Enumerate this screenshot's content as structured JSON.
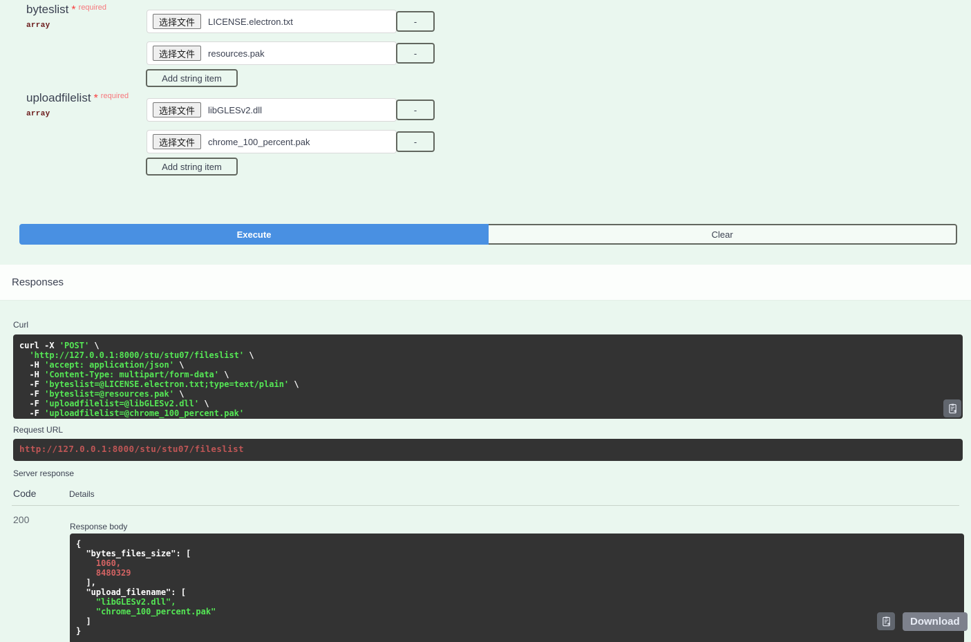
{
  "params": [
    {
      "name": "byteslist",
      "star": "*",
      "required": "required",
      "type": "array",
      "files": [
        {
          "button": "选择文件",
          "filename": "LICENSE.electron.txt",
          "remove": "-"
        },
        {
          "button": "选择文件",
          "filename": "resources.pak",
          "remove": "-"
        }
      ],
      "add_label": "Add string item"
    },
    {
      "name": "uploadfilelist",
      "star": "*",
      "required": "required",
      "type": "array",
      "files": [
        {
          "button": "选择文件",
          "filename": "libGLESv2.dll",
          "remove": "-"
        },
        {
          "button": "选择文件",
          "filename": "chrome_100_percent.pak",
          "remove": "-"
        }
      ],
      "add_label": "Add string item"
    }
  ],
  "actions": {
    "execute_label": "Execute",
    "clear_label": "Clear"
  },
  "responses": {
    "section_title": "Responses",
    "curl_label": "Curl",
    "request_url_label": "Request URL",
    "request_url": "http://127.0.0.1:8000/stu/stu07/fileslist",
    "server_response_label": "Server response",
    "col_code": "Code",
    "col_details": "Details",
    "status_code": "200",
    "response_body_label": "Response body",
    "download_label": "Download",
    "copy_icon_title": "copy-to-clipboard-icon",
    "curl": {
      "l1_cmd": "curl",
      "l1_flag": "-X",
      "l1_str": "'POST'",
      "l1_cont": "\\",
      "l2_str": "'http://127.0.0.1:8000/stu/stu07/fileslist'",
      "l2_cont": "\\",
      "l3_flag": "-H",
      "l3_str": "'accept: application/json'",
      "l3_cont": "\\",
      "l4_flag": "-H",
      "l4_str": "'Content-Type: multipart/form-data'",
      "l4_cont": "\\",
      "l5_flag": "-F",
      "l5_str": "'byteslist=@LICENSE.electron.txt;type=text/plain'",
      "l5_cont": "\\",
      "l6_flag": "-F",
      "l6_str": "'byteslist=@resources.pak'",
      "l6_cont": "\\",
      "l7_flag": "-F",
      "l7_str": "'uploadfilelist=@libGLESv2.dll'",
      "l7_cont": "\\",
      "l8_flag": "-F",
      "l8_str": "'uploadfilelist=@chrome_100_percent.pak'"
    },
    "body": {
      "open": "{",
      "key1": "\"bytes_files_size\": [",
      "num1": "1060,",
      "num2": "8480329",
      "close1": "],",
      "key2": "\"upload_filename\": [",
      "str1": "\"libGLESv2.dll\",",
      "str2": "\"chrome_100_percent.pak\"",
      "close2": "]",
      "close": "}"
    }
  }
}
